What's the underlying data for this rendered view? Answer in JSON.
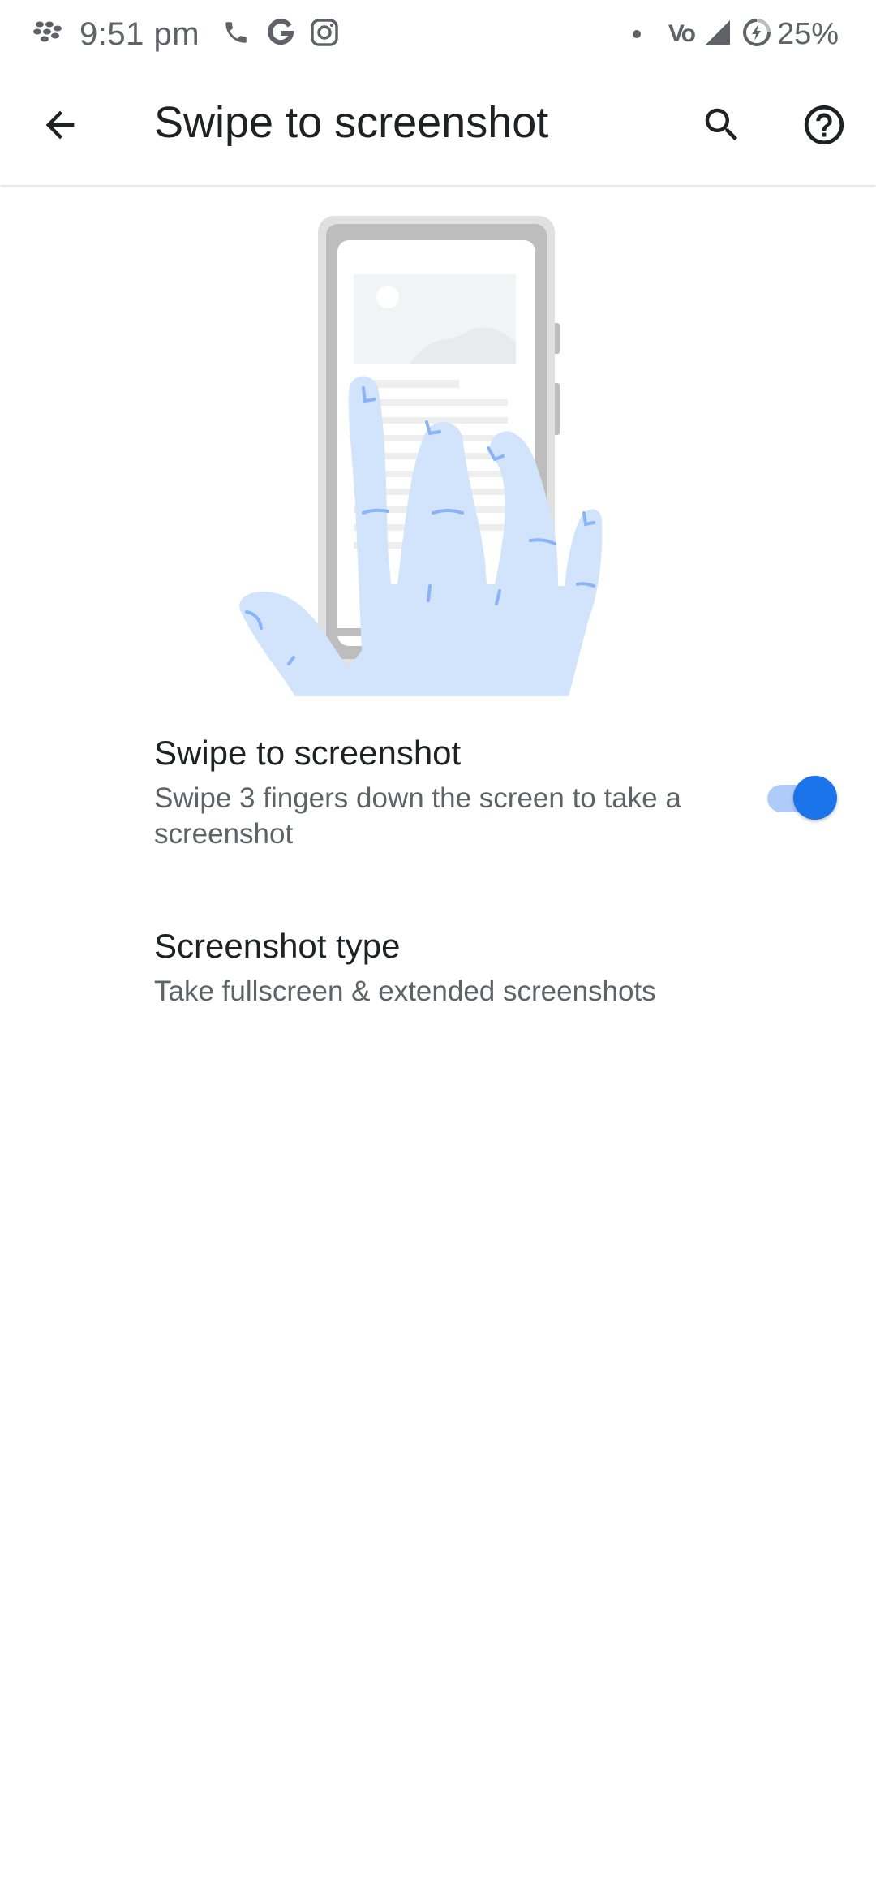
{
  "status_bar": {
    "time": "9:51 pm",
    "network_label": "Vo",
    "battery_percent": "25%",
    "icons": [
      "blackberry-icon",
      "phone-icon",
      "google-g-icon",
      "instagram-icon",
      "notification-dot-icon",
      "volte-icon",
      "signal-icon",
      "battery-saver-icon"
    ]
  },
  "app_bar": {
    "title": "Swipe to screenshot",
    "back_icon": "arrow-back-icon",
    "search_icon": "search-icon",
    "help_icon": "help-icon"
  },
  "illustration": {
    "name": "hand-swipe-phone-illustration",
    "colors": {
      "phone_frame": "#bdbdbd",
      "phone_screen": "#ffffff",
      "hand_fill": "#d2e3fc",
      "hand_lines": "#8ab4f8"
    }
  },
  "preferences": [
    {
      "title": "Swipe to screenshot",
      "summary": "Swipe 3 fingers down the screen to take a screenshot",
      "switch_on": true
    },
    {
      "title": "Screenshot type",
      "summary": "Take fullscreen & extended screenshots"
    }
  ],
  "colors": {
    "accent": "#1a73e8",
    "accent_track": "#aecbfa",
    "text_primary": "#202124",
    "text_secondary": "#5f6368"
  }
}
